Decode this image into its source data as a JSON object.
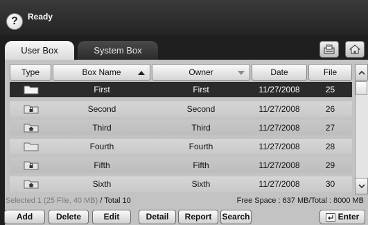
{
  "status": {
    "text": "Ready",
    "help_label": "?"
  },
  "tabs": [
    {
      "label": "User Box",
      "active": true
    },
    {
      "label": "System Box",
      "active": false
    }
  ],
  "table": {
    "columns": [
      "Type",
      "Box Name",
      "Owner",
      "Date",
      "File"
    ],
    "sort": {
      "column": "Box Name",
      "direction": "ascending"
    },
    "rows": [
      {
        "type": "folder",
        "name": "First",
        "owner": "First",
        "date": "11/27/2008",
        "file": "25",
        "selected": true
      },
      {
        "type": "locked-folder",
        "name": "Second",
        "owner": "Second",
        "date": "11/27/2008",
        "file": "26",
        "selected": false
      },
      {
        "type": "secure-folder",
        "name": "Third",
        "owner": "Third",
        "date": "11/27/2008",
        "file": "27",
        "selected": false
      },
      {
        "type": "folder",
        "name": "Fourth",
        "owner": "Fourth",
        "date": "11/27/2008",
        "file": "28",
        "selected": false
      },
      {
        "type": "locked-folder",
        "name": "Fifth",
        "owner": "Fifth",
        "date": "11/27/2008",
        "file": "29",
        "selected": false
      },
      {
        "type": "secure-folder",
        "name": "Sixth",
        "owner": "Sixth",
        "date": "11/27/2008",
        "file": "30",
        "selected": false
      }
    ]
  },
  "info": {
    "selected": "Selected 1 (25 File, 40 MB)",
    "total": " / Total 10",
    "space": "Free Space : 637 MB/Total : 8000 MB"
  },
  "buttons": {
    "add": "Add",
    "delete": "Delete",
    "edit": "Edit",
    "detail": "Detail",
    "report": "Report",
    "search": "Search",
    "enter": "Enter"
  },
  "icons": {
    "tray": "tray-icon",
    "home": "home-icon"
  },
  "colors": {
    "selected_row": "#2b2b2b",
    "status_bar": "#2e2e2e",
    "panel": "#c3c3c3"
  }
}
